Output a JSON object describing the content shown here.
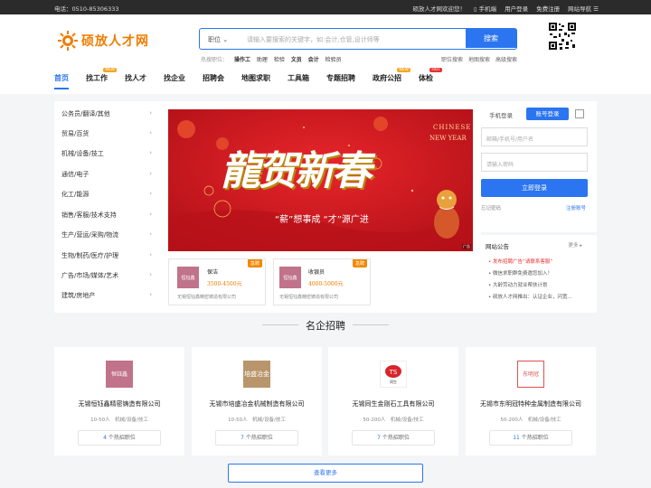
{
  "topbar": {
    "phone": "电话：0510-85306333",
    "welcome": "硕放人才网欢迎您！",
    "mobile": "手机端",
    "user_login": "用户登录",
    "register": "免费注册",
    "site_nav": "网站导航"
  },
  "logo": {
    "text": "硕放人才网"
  },
  "search": {
    "select_label": "职位",
    "placeholder": "请输入要搜索的关键字，如:会计,仓管,设计师等",
    "button": "搜索"
  },
  "hot": {
    "label": "热搜职位：",
    "items": [
      "操作工",
      "助理",
      "检验",
      "文员",
      "会计",
      "检验员"
    ]
  },
  "sublinks": [
    "职位搜索",
    "地图搜索",
    "高级搜索"
  ],
  "nav": [
    {
      "label": "首页",
      "tag": ""
    },
    {
      "label": "找工作",
      "tag": "NEW"
    },
    {
      "label": "找人才",
      "tag": ""
    },
    {
      "label": "找企业",
      "tag": ""
    },
    {
      "label": "招聘会",
      "tag": ""
    },
    {
      "label": "地图求职",
      "tag": ""
    },
    {
      "label": "工具箱",
      "tag": ""
    },
    {
      "label": "专题招聘",
      "tag": ""
    },
    {
      "label": "政府公招",
      "tag": "NEW"
    },
    {
      "label": "体检",
      "tag": "HOT"
    }
  ],
  "categories": [
    "公务员/翻译/其他",
    "贸易/百货",
    "机械/设备/技工",
    "通信/电子",
    "化工/能源",
    "销售/客服/技术支持",
    "生产/营运/采购/物流",
    "生物/制药/医疗/护理",
    "广告/市场/媒体/艺术",
    "建筑/房地产"
  ],
  "banner": {
    "big_text": "龍贺新春",
    "sub_text": "“薪”想事成 “才”源广进",
    "en_line1": "CHINESE",
    "en_line2": "NEW YEAR",
    "corner": "广告"
  },
  "urgent_jobs": [
    {
      "title": "保洁",
      "salary": "3500-4500元",
      "company": "无锡恒钰鑫精密铸造有限公司",
      "badge": "急聘",
      "logo_text": "恒钰鑫"
    },
    {
      "title": "收银员",
      "salary": "4000-5000元",
      "company": "无锡恒钰鑫精密铸造有限公司",
      "badge": "急聘",
      "logo_text": "恒钰鑫"
    }
  ],
  "login": {
    "tab_mobile": "手机登录",
    "tab_account": "账号登录",
    "user_placeholder": "邮箱/手机号/用户名",
    "pwd_placeholder": "请输入密码",
    "button": "立即登录",
    "forgot": "忘记密码",
    "register": "注册账号"
  },
  "notice": {
    "title": "网站公告",
    "more": "更多",
    "items": [
      "发布招聘广告“请联系客服”",
      "微信求职群免费邀您加入！",
      "大龄劳动力就业帮扶计划",
      "硕放人才网推出：认证企业，闪宽..."
    ]
  },
  "section": {
    "title": "名企招聘",
    "more": "查看更多"
  },
  "companies": [
    {
      "logo_text": "恒钰鑫",
      "name": "无锡恒钰鑫精密铸造有限公司",
      "size": "10-50人",
      "industry": "机械/设备/技工",
      "jobs": "4",
      "jobs_suffix": "个热招职位",
      "color": "#c0738a"
    },
    {
      "logo_text": "培盛冶金",
      "name": "无锡市培盛冶金机械制造有限公司",
      "size": "10-50人",
      "industry": "机械/设备/技工",
      "jobs": "7",
      "jobs_suffix": "个热招职位",
      "color": "#b9956b"
    },
    {
      "logo_text": "同生",
      "name": "无锡同生金刚石工具有限公司",
      "size": "50-200人",
      "industry": "机械/设备/技工",
      "jobs": "7",
      "jobs_suffix": "个热招职位",
      "color": "#d8242b"
    },
    {
      "logo_text": "东明冠",
      "name": "无锡市东明冠特种金属制造有限公司",
      "size": "50-200人",
      "industry": "机械/设备/技工",
      "jobs": "11",
      "jobs_suffix": "个热招职位",
      "color": "#d9534f"
    }
  ],
  "colors": {
    "primary": "#2b75f0",
    "brand": "#f07c00",
    "urgent": "#f08a00",
    "banner": "#c8141b"
  }
}
